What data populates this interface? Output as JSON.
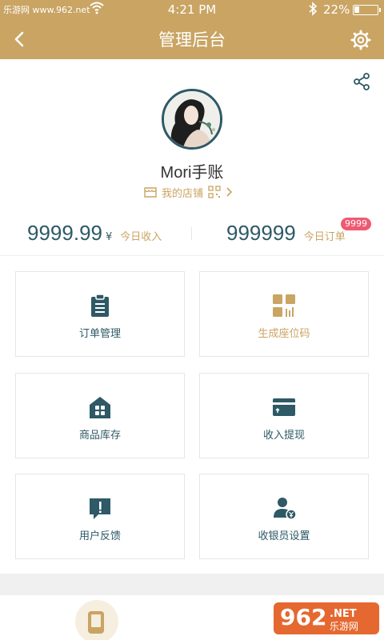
{
  "status_bar": {
    "watermark": "乐游网 www.962.net",
    "time": "4:21 PM",
    "battery_percent_text": "22%",
    "battery_level": 0.22
  },
  "nav": {
    "title": "管理后台",
    "back_icon": "chevron-left-icon",
    "settings_icon": "gear-icon"
  },
  "profile": {
    "share_icon": "share-icon",
    "shop_name": "Mori手账",
    "my_shop_label": "我的店铺",
    "avatar_icon": "avatar"
  },
  "stats": {
    "income_value": "9999.99",
    "income_currency": "¥",
    "income_label": "今日收入",
    "orders_value": "999999",
    "orders_label": "今日订单",
    "orders_badge": "9999"
  },
  "menu": [
    {
      "label": "订单管理",
      "icon": "clipboard-icon"
    },
    {
      "label": "生成座位码",
      "icon": "qrcode-icon"
    },
    {
      "label": "商品库存",
      "icon": "store-icon"
    },
    {
      "label": "收入提现",
      "icon": "card-icon"
    },
    {
      "label": "用户反馈",
      "icon": "feedback-icon"
    },
    {
      "label": "收银员设置",
      "icon": "cashier-user-icon"
    }
  ],
  "tabbar": {
    "home_icon": "phone-icon"
  },
  "watermark_logo": {
    "text_962": "962",
    "text_net": ".NET",
    "text_cn": "乐游网"
  },
  "colors": {
    "brand_gold": "#c9a463",
    "primary_teal": "#2e5966",
    "badge_pink": "#ef5a72",
    "background": "#ffffff"
  }
}
